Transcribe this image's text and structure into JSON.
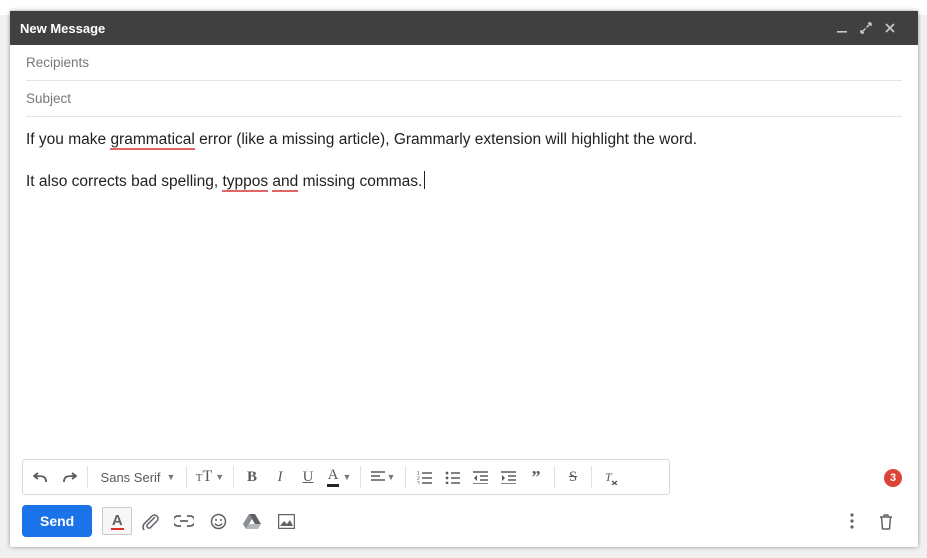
{
  "header": {
    "title": "New Message"
  },
  "fields": {
    "recipients_placeholder": "Recipients",
    "recipients_value": "",
    "subject_placeholder": "Subject",
    "subject_value": ""
  },
  "body": {
    "line1_pre": "If you make ",
    "line1_err1": "grammatical",
    "line1_post": " error (like a missing article), Grammarly extension will highlight the word.",
    "line2_pre": "It also corrects bad spelling, ",
    "line2_err1": "typpos",
    "line2_mid": " ",
    "line2_err2": "and",
    "line2_post": " missing commas."
  },
  "format_toolbar": {
    "font_name": "Sans Serif"
  },
  "bottom": {
    "send_label": "Send"
  },
  "badge": {
    "count": "3"
  },
  "colors": {
    "accent": "#1a73e8",
    "error_underline": "#e06666",
    "badge": "#db4437"
  }
}
